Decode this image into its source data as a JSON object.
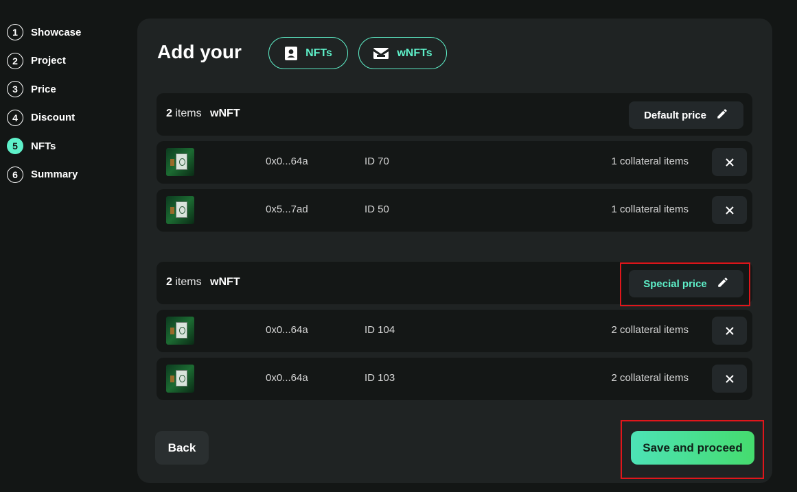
{
  "steps": [
    {
      "number": "1",
      "label": "Showcase"
    },
    {
      "number": "2",
      "label": "Project"
    },
    {
      "number": "3",
      "label": "Price"
    },
    {
      "number": "4",
      "label": "Discount"
    },
    {
      "number": "5",
      "label": "NFTs",
      "active": true
    },
    {
      "number": "6",
      "label": "Summary"
    }
  ],
  "header": {
    "title": "Add your",
    "nfts_label": "NFTs",
    "wnfts_label": "wNFTs",
    "nfts_icon": "id-card-icon",
    "wnfts_icon": "envelope-icon"
  },
  "groups": [
    {
      "count": "2",
      "items_word": "items",
      "type": "wNFT",
      "price_button": "Default price",
      "rows": [
        {
          "address": "0x0...64a",
          "id": "ID 70",
          "collateral": "1 collateral items"
        },
        {
          "address": "0x5...7ad",
          "id": "ID 50",
          "collateral": "1 collateral items"
        }
      ]
    },
    {
      "count": "2",
      "items_word": "items",
      "type": "wNFT",
      "price_button": "Special price",
      "rows": [
        {
          "address": "0x0...64a",
          "id": "ID 104",
          "collateral": "2 collateral items"
        },
        {
          "address": "0x0...64a",
          "id": "ID 103",
          "collateral": "2 collateral items"
        }
      ]
    }
  ],
  "footer": {
    "back_label": "Back",
    "save_label": "Save and proceed"
  },
  "colors": {
    "accent": "#5ef0c9",
    "highlight": "#e0161b",
    "background": "#131615",
    "panel": "#1f2323"
  }
}
